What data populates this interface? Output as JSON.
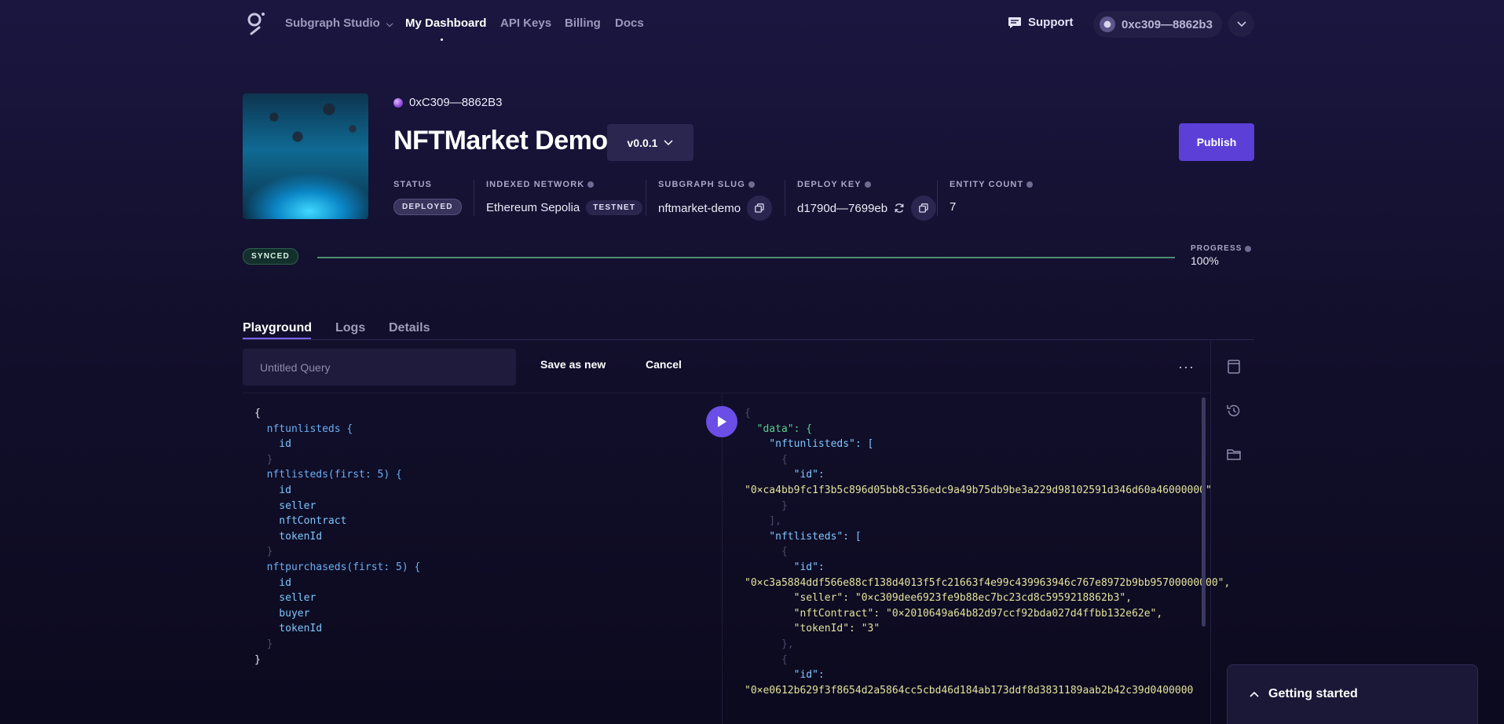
{
  "nav": {
    "brand": "Subgraph Studio",
    "items": [
      "My Dashboard",
      "API Keys",
      "Billing",
      "Docs"
    ],
    "support": "Support",
    "account": "0xc309—8862b3"
  },
  "header": {
    "owner": "0xC309—8862B3",
    "title": "NFTMarket Demo",
    "version": "v0.0.1",
    "publish": "Publish"
  },
  "meta": {
    "status_label": "STATUS",
    "status_value": "DEPLOYED",
    "network_label": "INDEXED NETWORK",
    "network_value": "Ethereum Sepolia",
    "network_badge": "TESTNET",
    "slug_label": "SUBGRAPH SLUG",
    "slug_value": "nftmarket-demo",
    "deploy_label": "DEPLOY KEY",
    "deploy_value": "d1790d—7699eb",
    "entity_label": "ENTITY COUNT",
    "entity_value": "7"
  },
  "sync": {
    "status": "SYNCED",
    "progress_label": "PROGRESS",
    "progress_value": "100%",
    "progress_fraction": 1.0
  },
  "tabs": [
    "Playground",
    "Logs",
    "Details"
  ],
  "playground": {
    "query_placeholder": "Untitled Query",
    "save_as_new": "Save as new",
    "cancel": "Cancel",
    "more": "···",
    "query_lines": [
      "{",
      "  nftunlisteds {",
      "    id",
      "  }",
      "  nftlisteds(first: 5) {",
      "    id",
      "    seller",
      "    nftContract",
      "    tokenId",
      "  }",
      "  nftpurchaseds(first: 5) {",
      "    id",
      "    seller",
      "    buyer",
      "    tokenId",
      "  }",
      "}"
    ],
    "result_lines": [
      "{",
      "  \"data\": {",
      "    \"nftunlisteds\": [",
      "      {",
      "        \"id\":",
      "\"0×ca4bb9fc1f3b5c896d05bb8c536edc9a49b75db9be3a229d98102591d346d60a46000000\"",
      "      }",
      "    ],",
      "    \"nftlisteds\": [",
      "      {",
      "        \"id\":",
      "\"0×c3a5884ddf566e88cf138d4013f5fc21663f4e99c439963946c767e8972b9bb95700000000\",",
      "        \"seller\": \"0×c309dee6923fe9b88ec7bc23cd8c5959218862b3\",",
      "        \"nftContract\": \"0×2010649a64b82d97ccf92bda027d4ffbb132e62e\",",
      "        \"tokenId\": \"3\"",
      "      },",
      "      {",
      "        \"id\":",
      "\"0×e0612b629f3f8654d2a5864cc5cbd46d184ab173ddf8d3831189aab2b42c39d0400000"
    ]
  },
  "getting_started": "Getting started",
  "icons": {
    "logo": "graph-logo-icon",
    "support": "chat-bubble-icon",
    "copy": "copy-icon",
    "refresh": "refresh-icon",
    "run": "play-icon",
    "docs": "document-icon",
    "history": "history-icon",
    "saved": "folder-icon"
  },
  "colors": {
    "accent": "#5b3fd6",
    "sync": "#4f8d76",
    "background": "#120f2c"
  }
}
